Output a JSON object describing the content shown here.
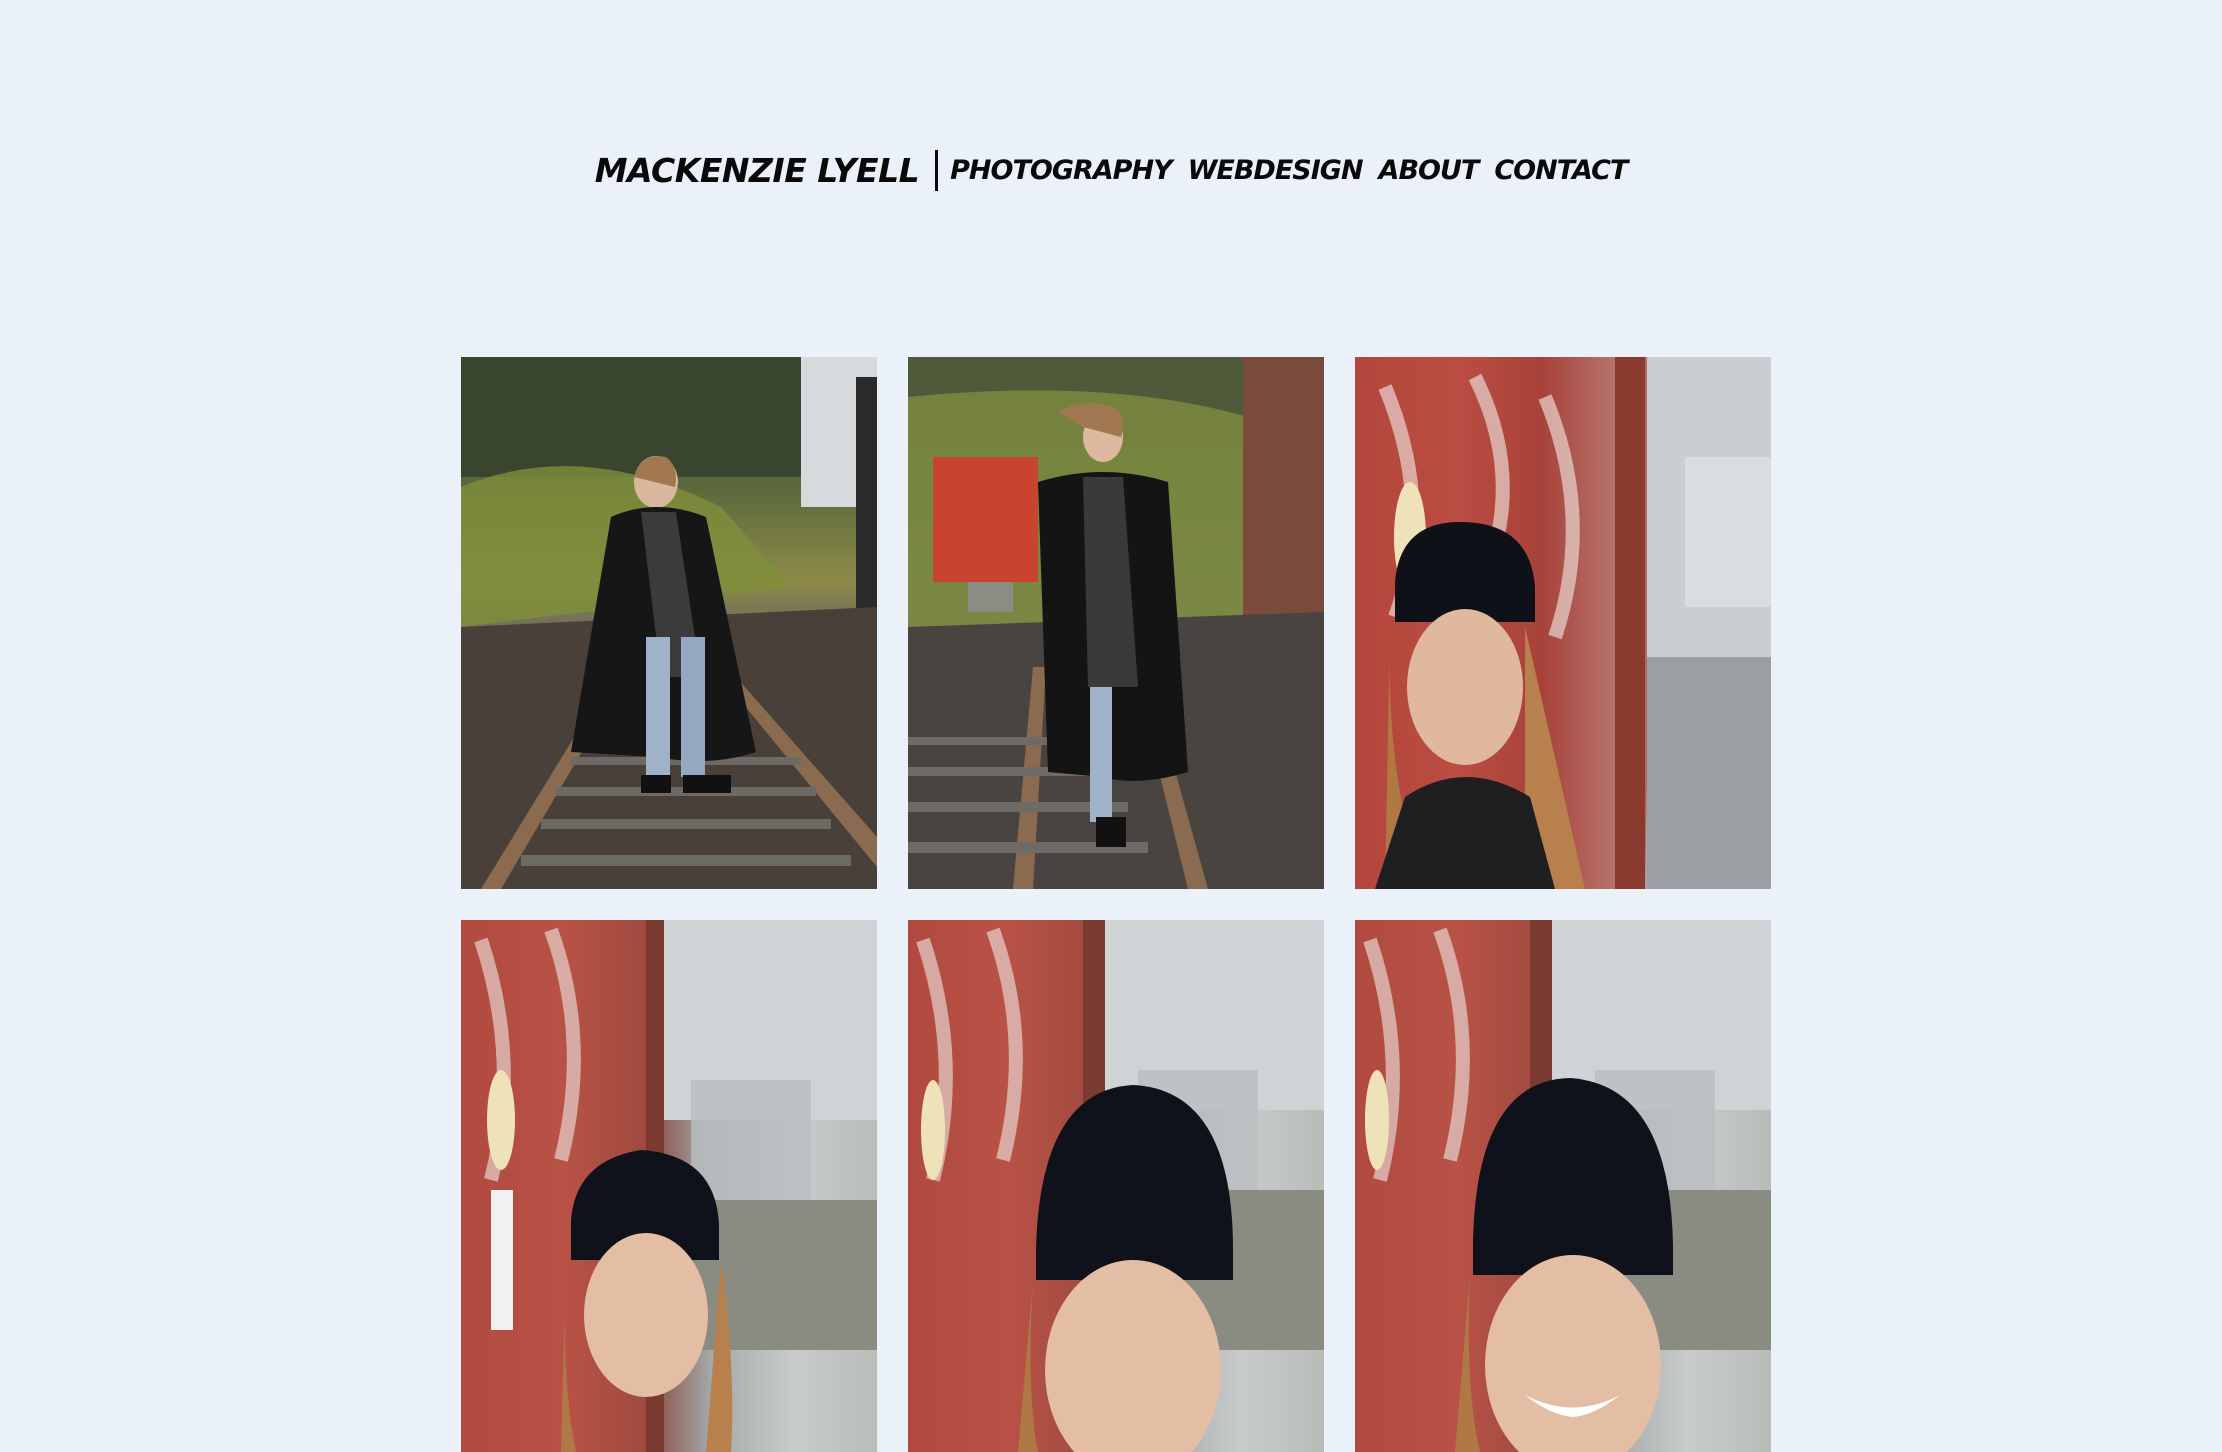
{
  "header": {
    "brand": "MACKENZIE LYELL",
    "nav": [
      {
        "label": "PHOTOGRAPHY"
      },
      {
        "label": "WEBDESIGN"
      },
      {
        "label": "ABOUT"
      },
      {
        "label": "CONTACT"
      }
    ]
  },
  "gallery": {
    "photos": [
      {
        "subject": "woman in black coat and scarf walking on railway tracks beside a mossy wall"
      },
      {
        "subject": "woman in black coat on railway tracks with hair blowing, red container behind"
      },
      {
        "subject": "woman in black beanie leaning against graffiti wall"
      },
      {
        "subject": "woman in black beanie smiling by graffiti wall"
      },
      {
        "subject": "close-up of woman in black beanie by graffiti wall"
      },
      {
        "subject": "woman in black beanie laughing by graffiti wall"
      }
    ]
  },
  "colors": {
    "background": "#ebf1f9",
    "text": "#0a0a0a"
  }
}
